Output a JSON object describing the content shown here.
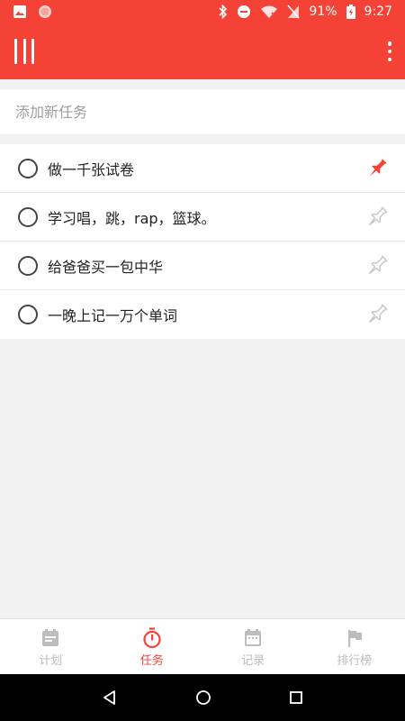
{
  "status_bar": {
    "battery": "91%",
    "time": "9:27",
    "icons": [
      "image-icon",
      "record-icon",
      "bluetooth-icon",
      "dnd-icon",
      "wifi-icon",
      "no-sim-icon",
      "battery-charging-icon"
    ]
  },
  "app_bar": {
    "menu_icon": "menu-icon",
    "more_icon": "more-vert-icon"
  },
  "add_task": {
    "placeholder": "添加新任务"
  },
  "tasks": [
    {
      "text": "做一千张试卷",
      "pinned": true
    },
    {
      "text": "学习唱，跳，rap，篮球。",
      "pinned": false
    },
    {
      "text": "给爸爸买一包中华",
      "pinned": false
    },
    {
      "text": "一晚上记一万个单词",
      "pinned": false
    }
  ],
  "bottom_nav": [
    {
      "label": "计划",
      "icon": "plan-icon",
      "active": false
    },
    {
      "label": "任务",
      "icon": "timer-icon",
      "active": true
    },
    {
      "label": "记录",
      "icon": "calendar-icon",
      "active": false
    },
    {
      "label": "排行榜",
      "icon": "flag-icon",
      "active": false
    }
  ],
  "colors": {
    "primary": "#f44336",
    "inactive": "#bdbdbd",
    "pin_inactive": "#c8c8c8"
  }
}
